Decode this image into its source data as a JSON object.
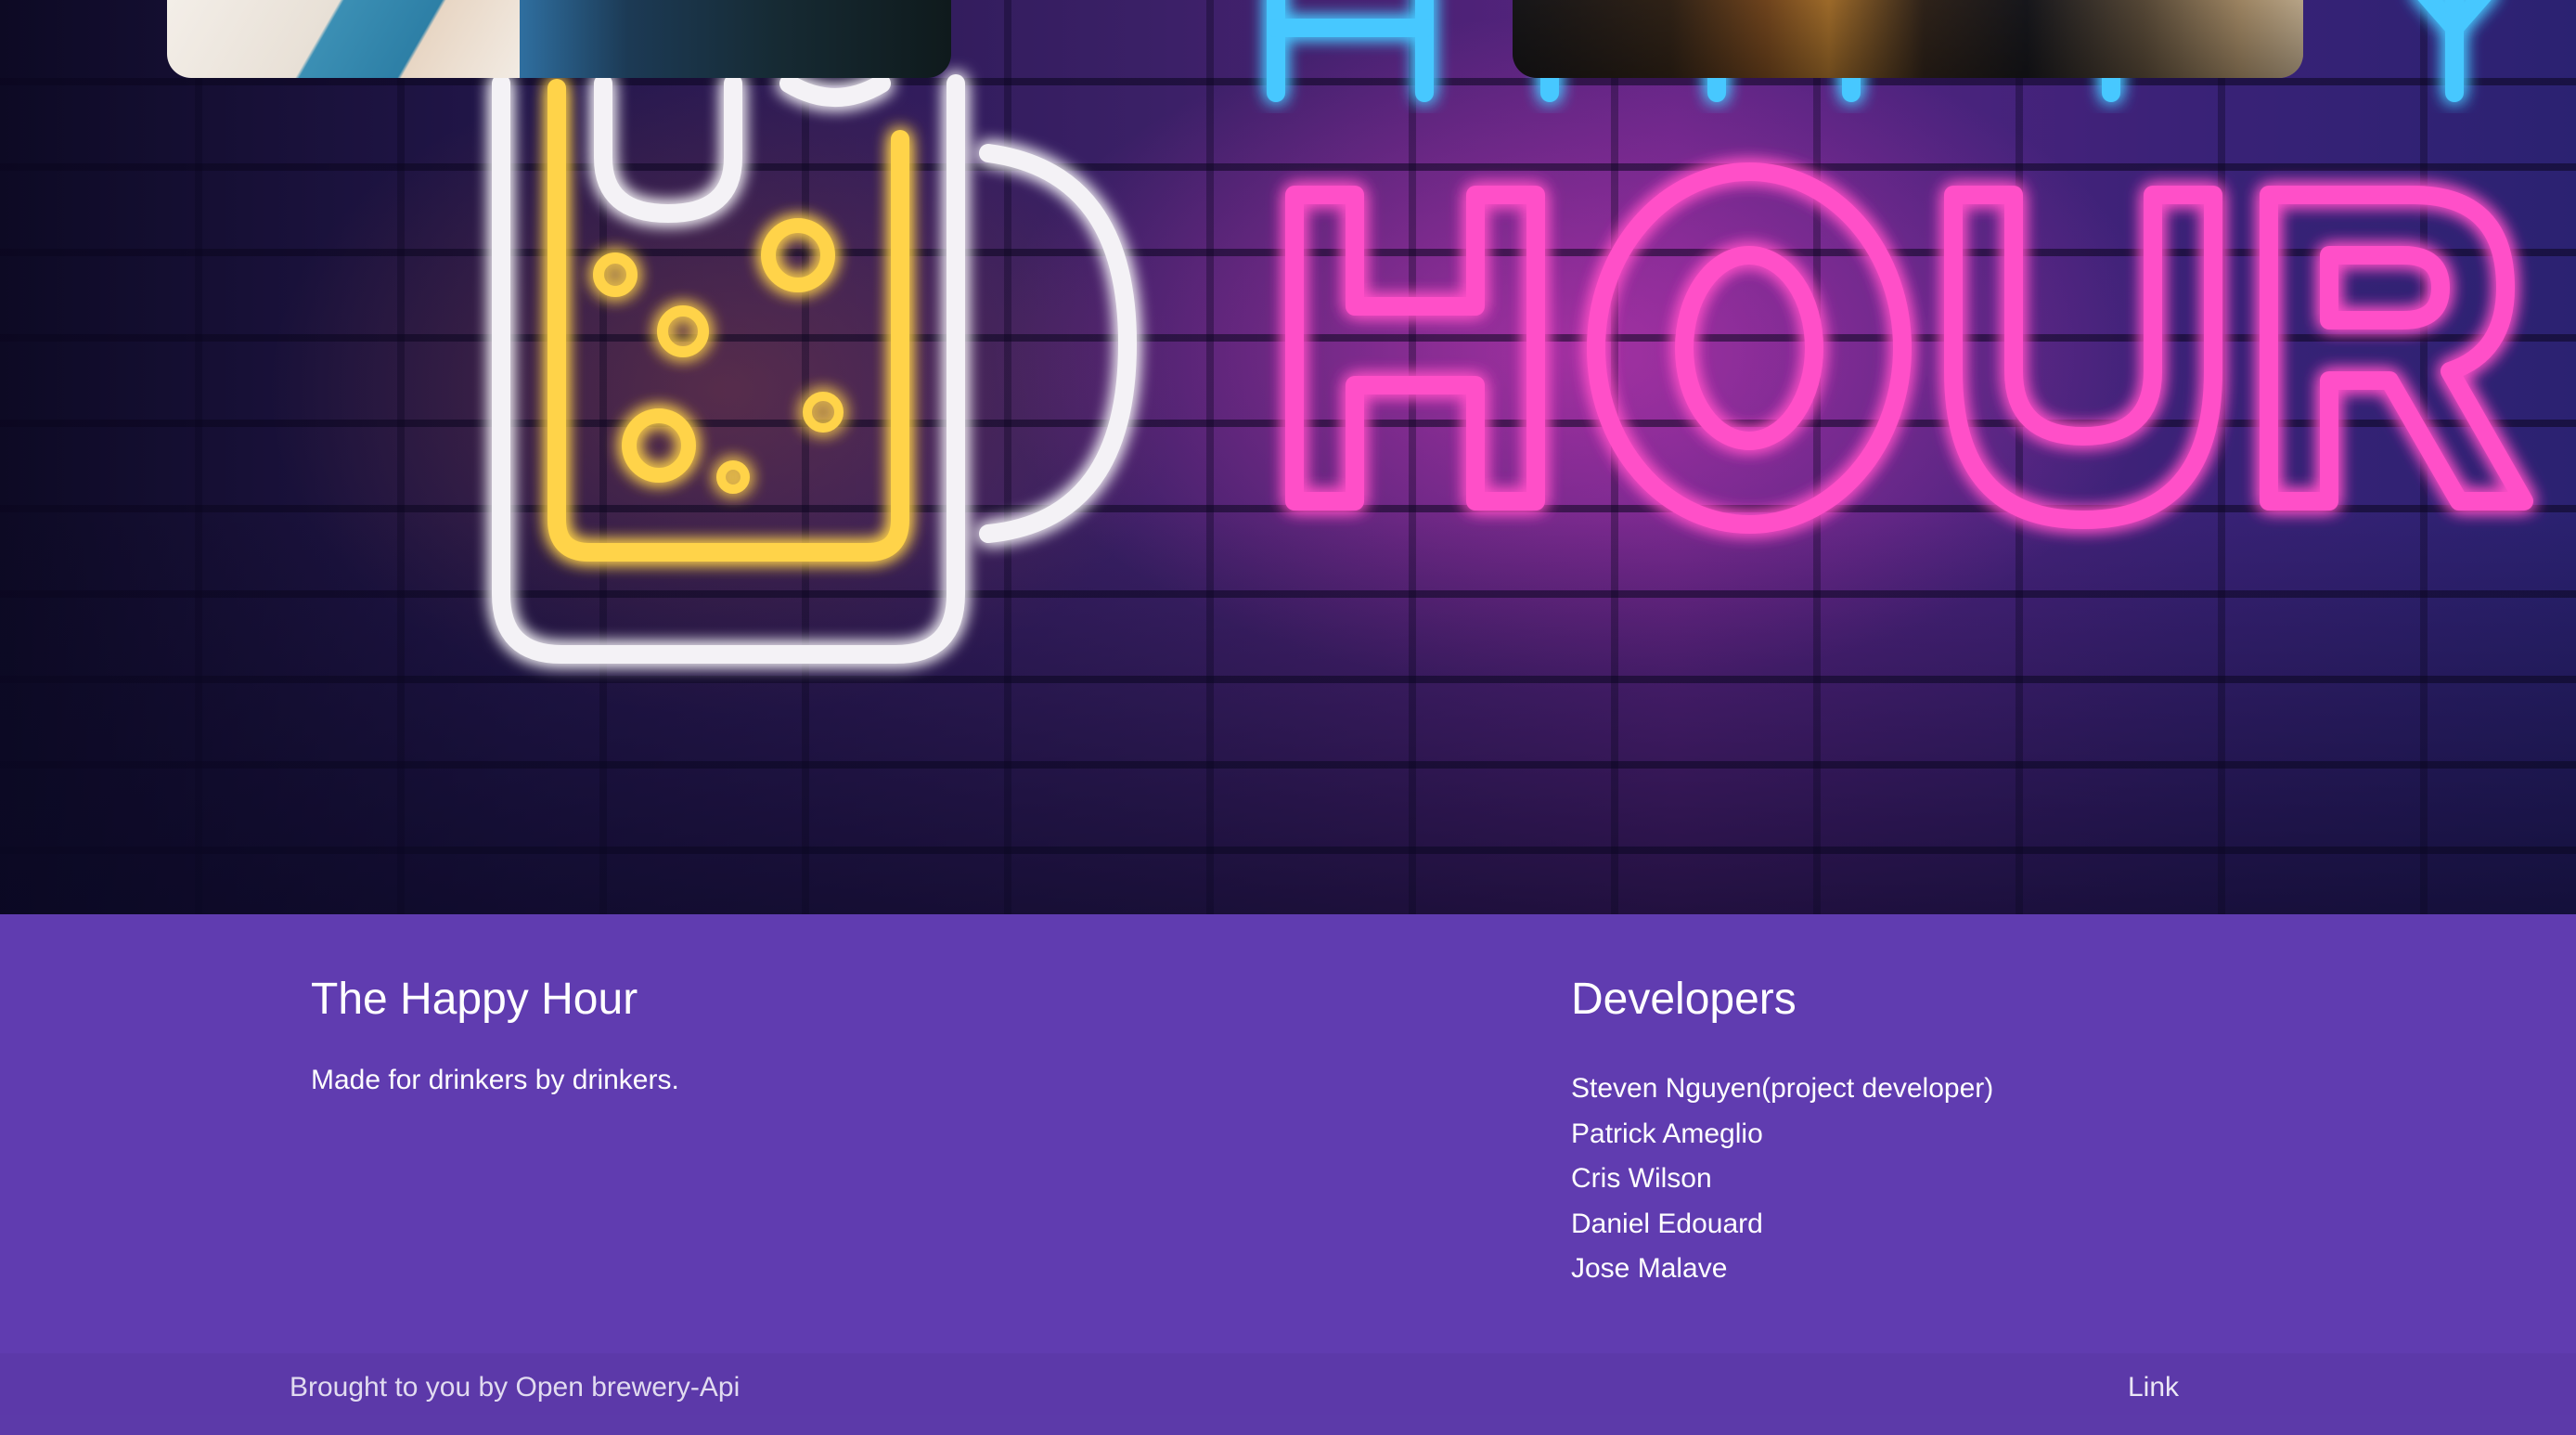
{
  "hero": {
    "image": "happy-hour-neon-sign",
    "sign_text": "HOUR",
    "accent_colors": {
      "pink_neon": "#ff4fc8",
      "blue_neon": "#46c8ff",
      "yellow_neon": "#ffd34a",
      "purple_neon": "#c77bff"
    }
  },
  "footer": {
    "background": "#603cb0",
    "brand": {
      "title": "The Happy Hour",
      "tagline": "Made for drinkers by drinkers."
    },
    "developers": {
      "title": "Developers",
      "names": [
        "Steven Nguyen(project developer)",
        "Patrick Ameglio",
        "Cris Wilson",
        "Daniel Edouard",
        "Jose Malave"
      ]
    },
    "copyright": {
      "text": "Brought to you by Open brewery-Api",
      "link_label": "Link"
    }
  }
}
